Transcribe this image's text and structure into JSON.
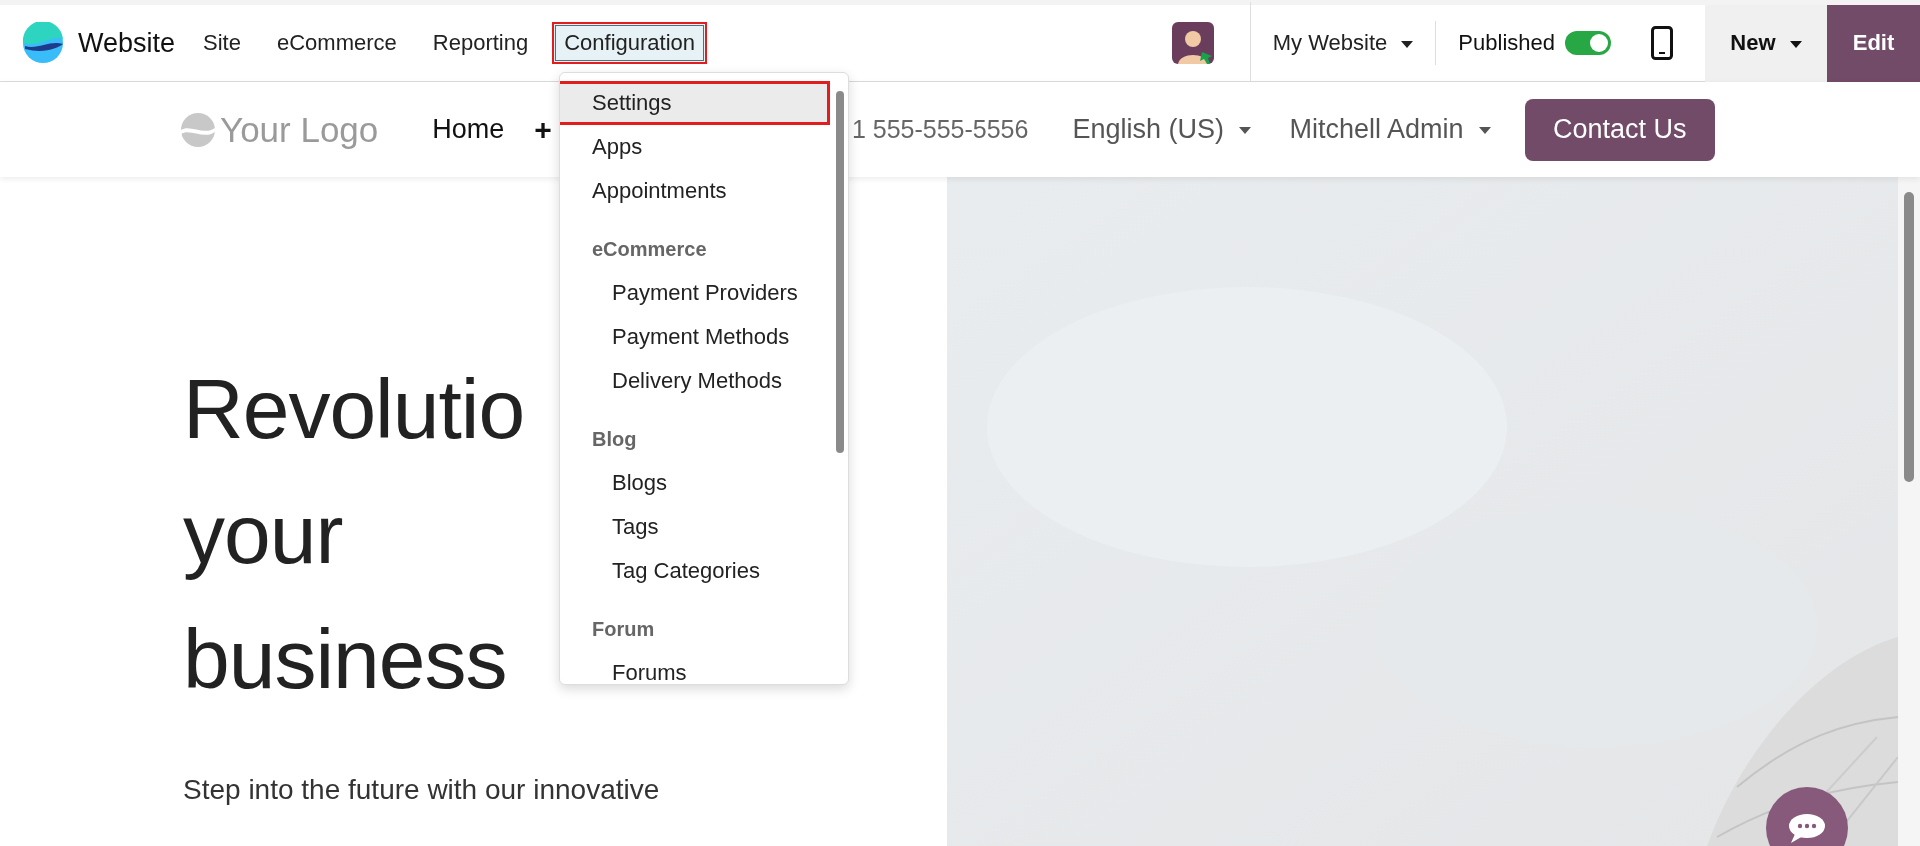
{
  "topbar": {
    "app_name": "Website",
    "menus": [
      {
        "label": "Site",
        "selected": false
      },
      {
        "label": "eCommerce",
        "selected": false
      },
      {
        "label": "Reporting",
        "selected": false
      },
      {
        "label": "Configuration",
        "selected": true
      }
    ],
    "website_switcher": "My Website",
    "published_label": "Published",
    "published": true,
    "new_button": "New",
    "edit_button": "Edit"
  },
  "dropdown": [
    {
      "kind": "item",
      "label": "Settings",
      "selected": true
    },
    {
      "kind": "item",
      "label": "Apps",
      "selected": false
    },
    {
      "kind": "item",
      "label": "Appointments",
      "selected": false
    },
    {
      "kind": "header",
      "label": "eCommerce"
    },
    {
      "kind": "subitem",
      "label": "Payment Providers",
      "selected": false
    },
    {
      "kind": "subitem",
      "label": "Payment Methods",
      "selected": false
    },
    {
      "kind": "subitem",
      "label": "Delivery Methods",
      "selected": false
    },
    {
      "kind": "header",
      "label": "Blog"
    },
    {
      "kind": "subitem",
      "label": "Blogs",
      "selected": false
    },
    {
      "kind": "subitem",
      "label": "Tags",
      "selected": false
    },
    {
      "kind": "subitem",
      "label": "Tag Categories",
      "selected": false
    },
    {
      "kind": "header",
      "label": "Forum"
    },
    {
      "kind": "subitem",
      "label": "Forums",
      "selected": false
    }
  ],
  "site_header": {
    "logo": "Your Logo",
    "nav": [
      "Home",
      "+"
    ],
    "phone": "1 555-555-5556",
    "language": "English (US)",
    "user": "Mitchell Admin",
    "cta": "Contact Us"
  },
  "hero": {
    "title_lines": [
      "Revolutio",
      "your",
      "business"
    ],
    "text": "Step into the future with our innovative",
    "image": {
      "kind": "picture"
    }
  }
}
